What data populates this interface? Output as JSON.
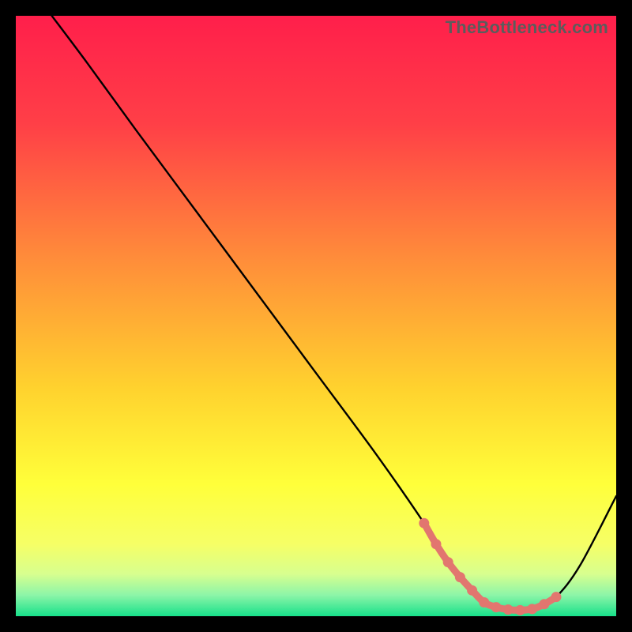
{
  "watermark": "TheBottleneck.com",
  "chart_data": {
    "type": "line",
    "title": "",
    "xlabel": "",
    "ylabel": "",
    "xlim": [
      0,
      100
    ],
    "ylim": [
      0,
      100
    ],
    "gradient_stops": [
      {
        "offset": 0.0,
        "color": "#ff1f4b"
      },
      {
        "offset": 0.18,
        "color": "#ff3f47"
      },
      {
        "offset": 0.4,
        "color": "#ff8b3a"
      },
      {
        "offset": 0.62,
        "color": "#ffd22e"
      },
      {
        "offset": 0.78,
        "color": "#ffff3a"
      },
      {
        "offset": 0.88,
        "color": "#f6ff66"
      },
      {
        "offset": 0.93,
        "color": "#d7ff8f"
      },
      {
        "offset": 0.965,
        "color": "#8cf5a8"
      },
      {
        "offset": 1.0,
        "color": "#17e08a"
      }
    ],
    "series": [
      {
        "name": "bottleneck-curve",
        "color": "#000000",
        "x": [
          6,
          12,
          20,
          30,
          40,
          50,
          60,
          68,
          72,
          75,
          78,
          81,
          84,
          87,
          90,
          94,
          100
        ],
        "values": [
          100,
          92,
          81,
          67.5,
          54,
          40.5,
          27,
          15.5,
          9,
          5,
          2.3,
          1.2,
          1.0,
          1.3,
          3.2,
          8.5,
          20
        ]
      }
    ],
    "highlight": {
      "name": "sweet-spot",
      "color": "#e2766f",
      "x": [
        68,
        70,
        72,
        74,
        76,
        78,
        80,
        82,
        84,
        86,
        88,
        90
      ],
      "values": [
        15.5,
        12.0,
        9.0,
        6.5,
        4.3,
        2.3,
        1.5,
        1.1,
        1.0,
        1.2,
        2.0,
        3.2
      ]
    }
  }
}
